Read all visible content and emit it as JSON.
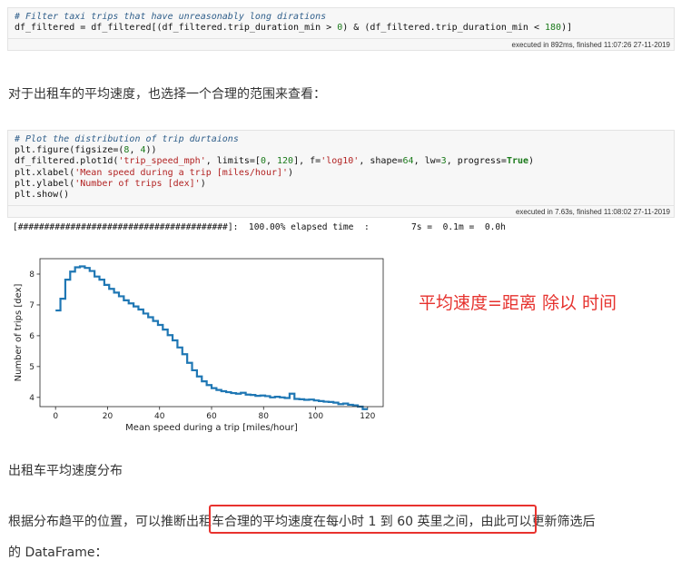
{
  "cell1": {
    "comment": "# Filter taxi trips that have unreasonably long dirations",
    "code_a": "df_filtered = df_filtered[(df_filtered.trip_duration_min > ",
    "num_a": "0",
    "code_b": ") & (df_filtered.trip_duration_min < ",
    "num_b": "180",
    "code_c": ")]",
    "exec": "executed in 892ms, finished 11:07:26 27-11-2019"
  },
  "para1": "对于出租车的平均速度，也选择一个合理的范围来查看：",
  "cell2": {
    "comment": "# Plot the distribution of trip durtaions",
    "l1a": "plt.figure(figsize=(",
    "l1n1": "8",
    "l1b": ", ",
    "l1n2": "4",
    "l1c": "))",
    "l2a": "df_filtered.plot1d(",
    "l2s1": "'trip_speed_mph'",
    "l2b": ", limits=[",
    "l2n1": "0",
    "l2c": ", ",
    "l2n2": "120",
    "l2d": "], f=",
    "l2s2": "'log10'",
    "l2e": ", shape=",
    "l2n3": "64",
    "l2f": ", lw=",
    "l2n4": "3",
    "l2g": ", progress=",
    "l2k": "True",
    "l2h": ")",
    "l3a": "plt.xlabel(",
    "l3s": "'Mean speed during a trip [miles/hour]'",
    "l3b": ")",
    "l4a": "plt.ylabel(",
    "l4s": "'Number of trips [dex]'",
    "l4b": ")",
    "l5": "plt.show()",
    "exec": "executed in 7.63s, finished 11:08:02 27-11-2019"
  },
  "progress": "[########################################]:  100.00% elapsed time  :        7s =  0.1m =  0.0h",
  "annotation": "平均速度=距离 除以 时间",
  "caption": "出租车平均速度分布",
  "para2": {
    "before": "根据分布趋平的位置，可以推断",
    "highlight": "出租车合理的平均速度在每小时 1 到 60 英里之间",
    "after": "，由此可以更新筛选后",
    "line2": "的 DataFrame："
  },
  "colors": {
    "line": "#1f77b4",
    "annotation": "#e6322e",
    "highlight_border": "#e8322e"
  },
  "chart_data": {
    "type": "line",
    "title": "",
    "xlabel": "Mean speed during a trip [miles/hour]",
    "ylabel": "Number of trips [dex]",
    "xlim": [
      -6,
      126
    ],
    "ylim": [
      3.7,
      8.5
    ],
    "xticks": [
      0,
      20,
      40,
      60,
      80,
      100,
      120
    ],
    "yticks": [
      4,
      5,
      6,
      7,
      8
    ],
    "x_tick_labels": [
      "0",
      "20",
      "40",
      "60",
      "80",
      "100",
      "120"
    ],
    "y_tick_labels": [
      "4",
      "5",
      "6",
      "7",
      "8"
    ],
    "step": true,
    "series": [
      {
        "x": [
          0,
          1.875,
          3.75,
          5.625,
          7.5,
          9.375,
          11.25,
          13.125,
          15,
          16.875,
          18.75,
          20.625,
          22.5,
          24.375,
          26.25,
          28.125,
          30,
          31.875,
          33.75,
          35.625,
          37.5,
          39.375,
          41.25,
          43.125,
          45,
          46.875,
          48.75,
          50.625,
          52.5,
          54.375,
          56.25,
          58.125,
          60,
          61.875,
          63.75,
          65.625,
          67.5,
          69.375,
          71.25,
          73.125,
          75,
          76.875,
          78.75,
          80.625,
          82.5,
          84.375,
          86.25,
          88.125,
          90,
          91.875,
          93.75,
          95.625,
          97.5,
          99.375,
          101.25,
          103.125,
          105,
          106.875,
          108.75,
          110.625,
          112.5,
          114.375,
          116.25,
          118.125
        ],
        "y": [
          6.82,
          7.2,
          7.82,
          8.08,
          8.22,
          8.25,
          8.2,
          8.1,
          7.92,
          7.82,
          7.65,
          7.52,
          7.4,
          7.28,
          7.15,
          7.05,
          6.95,
          6.85,
          6.72,
          6.6,
          6.48,
          6.35,
          6.2,
          6.02,
          5.85,
          5.62,
          5.4,
          5.12,
          4.88,
          4.68,
          4.52,
          4.4,
          4.3,
          4.24,
          4.2,
          4.17,
          4.14,
          4.12,
          4.15,
          4.09,
          4.08,
          4.05,
          4.06,
          4.04,
          4.0,
          4.02,
          4.0,
          3.98,
          4.12,
          3.95,
          3.94,
          3.92,
          3.93,
          3.9,
          3.88,
          3.86,
          3.85,
          3.83,
          3.78,
          3.8,
          3.76,
          3.74,
          3.7,
          3.62
        ]
      }
    ]
  }
}
